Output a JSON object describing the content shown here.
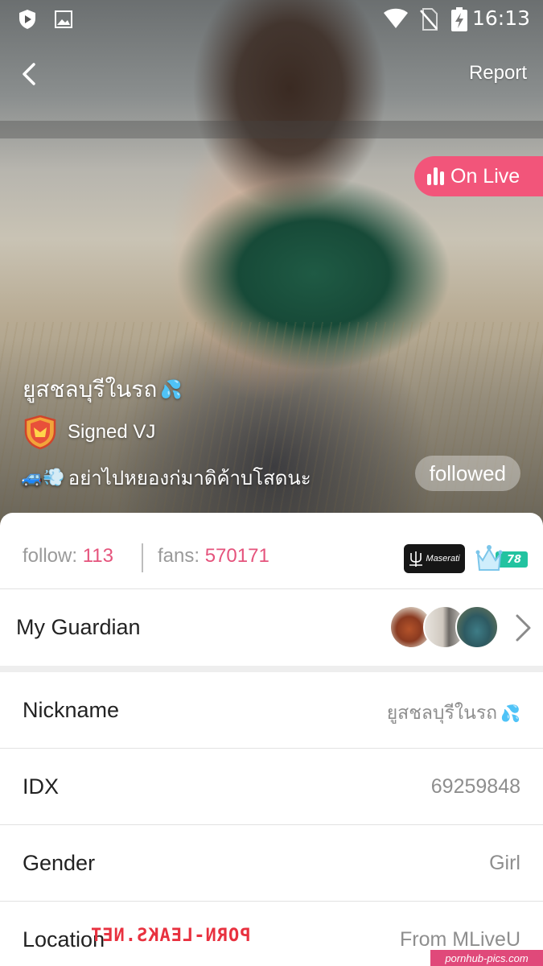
{
  "status_bar": {
    "time": "16:13",
    "icons": [
      "shield-play-icon",
      "image-icon",
      "wifi-icon",
      "no-sim-icon",
      "battery-charging-icon"
    ]
  },
  "header": {
    "back_icon": "chevron-left-icon",
    "report_label": "Report"
  },
  "live_badge": {
    "label": "On Live",
    "color": "#f2557a"
  },
  "profile": {
    "name": "ยูสชลบุรีในรถ",
    "name_emoji": "💦",
    "role_label": "Signed VJ",
    "status_emoji": "🚙💨",
    "status_text": "อย่าไปหยองก่มาดิค้าบโสดนะ",
    "follow_state_label": "followed"
  },
  "stats": {
    "follow_label": "follow:",
    "follow_value": "113",
    "fans_label": "fans:",
    "fans_value": "570171",
    "car_badge_label": "Maserati",
    "level_value": "78",
    "accent_color": "#e5537c"
  },
  "guardian": {
    "label": "My Guardian",
    "avatars": [
      "guardian-avatar-1",
      "guardian-avatar-2",
      "guardian-avatar-3"
    ]
  },
  "info": {
    "nickname_label": "Nickname",
    "nickname_value": "ยูสชลบุรีในรถ",
    "nickname_emoji": "💦",
    "idx_label": "IDX",
    "idx_value": "69259848",
    "gender_label": "Gender",
    "gender_value": "Girl",
    "location_label": "Location",
    "location_value": "From MLiveU"
  },
  "watermarks": {
    "mid": "PORN-LEAKS.NET",
    "corner": "pornhub-pics.com"
  }
}
